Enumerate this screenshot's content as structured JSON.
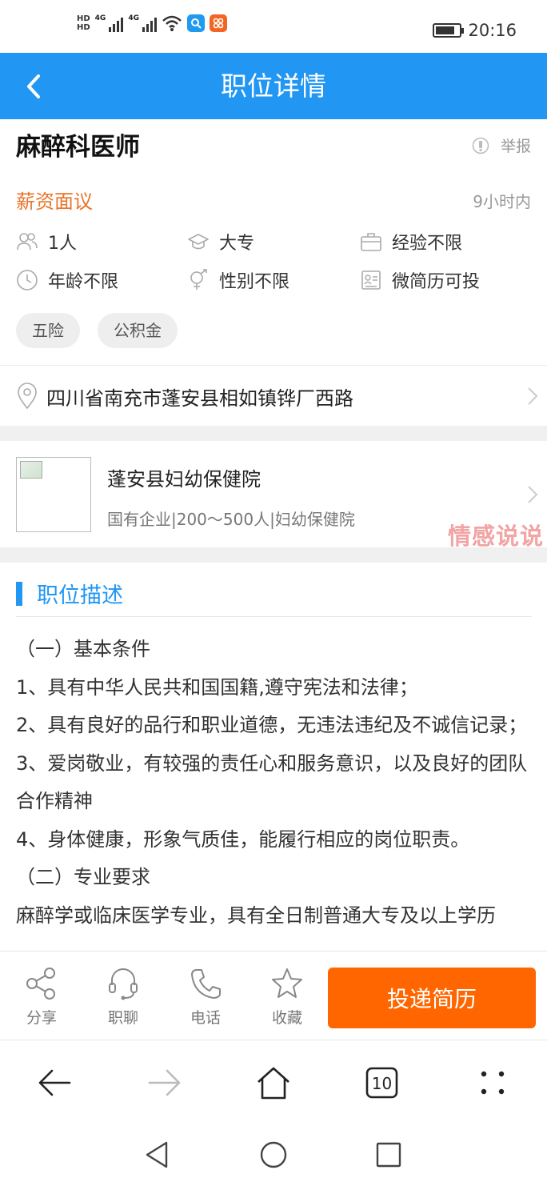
{
  "status_bar": {
    "time": "20:16",
    "hd1": "HD",
    "hd2": "HD",
    "net1": "4G",
    "net2": "4G",
    "app_badge_icons": [
      "search-app-icon",
      "grid-app-icon"
    ]
  },
  "header": {
    "title": "职位详情"
  },
  "job": {
    "title": "麻醉科医师",
    "report_label": "举报",
    "salary": "薪资面议",
    "posted": "9小时内",
    "attributes": [
      {
        "icon": "people-icon",
        "text": "1人"
      },
      {
        "icon": "graduation-cap-icon",
        "text": "大专"
      },
      {
        "icon": "briefcase-icon",
        "text": "经验不限"
      },
      {
        "icon": "clock-icon",
        "text": "年龄不限"
      },
      {
        "icon": "gender-icon",
        "text": "性别不限"
      },
      {
        "icon": "resume-icon",
        "text": "微简历可投"
      }
    ],
    "tags": [
      "五险",
      "公积金"
    ],
    "address": "四川省南充市蓬安县相如镇铧厂西路"
  },
  "company": {
    "name": "蓬安县妇幼保健院",
    "info": "国有企业|200～500人|妇幼保健院",
    "watermark": "情感说说"
  },
  "description": {
    "heading": "职位描述",
    "lines": [
      "（一）基本条件",
      "1、具有中华人民共和国国籍,遵守宪法和法律；",
      "2、具有良好的品行和职业道德，无违法违纪及不诚信记录；",
      "3、爱岗敬业，有较强的责任心和服务意识，以及良好的团队合作精神",
      "4、身体健康，形象气质佳，能履行相应的岗位职责。",
      "（二）专业要求",
      "麻醉学或临床医学专业，具有全日制普通大专及以上学历"
    ]
  },
  "actions": {
    "share": "分享",
    "chat": "职聊",
    "phone": "电话",
    "favorite": "收藏",
    "apply": "投递简历"
  },
  "browser_nav": {
    "tab_count": "10"
  },
  "colors": {
    "header_bg": "#2196f3",
    "accent_orange": "#ff6600",
    "salary_orange": "#e8742a",
    "watermark": "#f19a9a"
  }
}
